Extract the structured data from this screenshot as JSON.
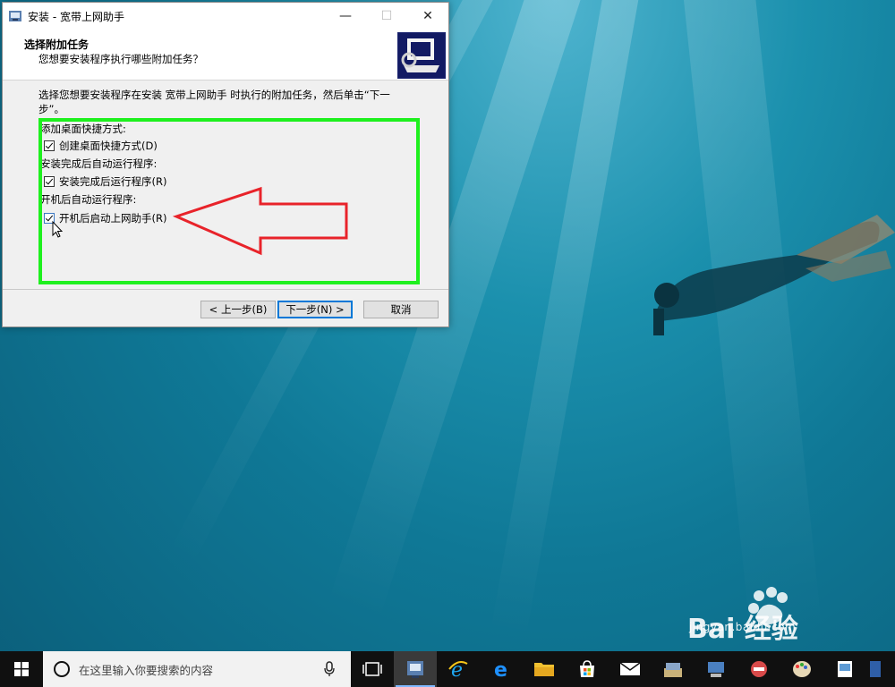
{
  "dialog": {
    "title": "安装 - 宽带上网助手",
    "header_title": "选择附加任务",
    "header_subtitle": "您想要安装程序执行哪些附加任务？",
    "description": "选择您想要安装程序在安装 宽带上网助手 时执行的附加任务，然后单击“下一步”。",
    "groups": [
      {
        "label": "添加桌面快捷方式:",
        "checkbox": {
          "label": "创建桌面快捷方式(D)",
          "checked": true
        }
      },
      {
        "label": "安装完成后自动运行程序:",
        "checkbox": {
          "label": "安装完成后运行程序(R)",
          "checked": true
        }
      },
      {
        "label": "开机后自动运行程序:",
        "checkbox": {
          "label": "开机后启动上网助手(R)",
          "checked": true
        }
      }
    ],
    "buttons": {
      "back": "< 上一步(B)",
      "next": "下一步(N) >",
      "cancel": "取消"
    }
  },
  "taskbar": {
    "search_placeholder": "在这里输入你要搜索的内容",
    "icons": [
      "task-view-icon",
      "installer-icon",
      "ie-icon",
      "edge-icon",
      "file-explorer-icon",
      "store-icon",
      "mail-icon",
      "app-icon-1",
      "app-icon-2",
      "app-icon-3",
      "paint-icon",
      "app-icon-4",
      "app-icon-5"
    ]
  },
  "watermark": {
    "brand": "Bai 经验",
    "url": "jingyan.baidu.com"
  },
  "colors": {
    "highlight_box": "#1ef01e",
    "arrow": "#e8232a",
    "taskbar": "#101010"
  }
}
